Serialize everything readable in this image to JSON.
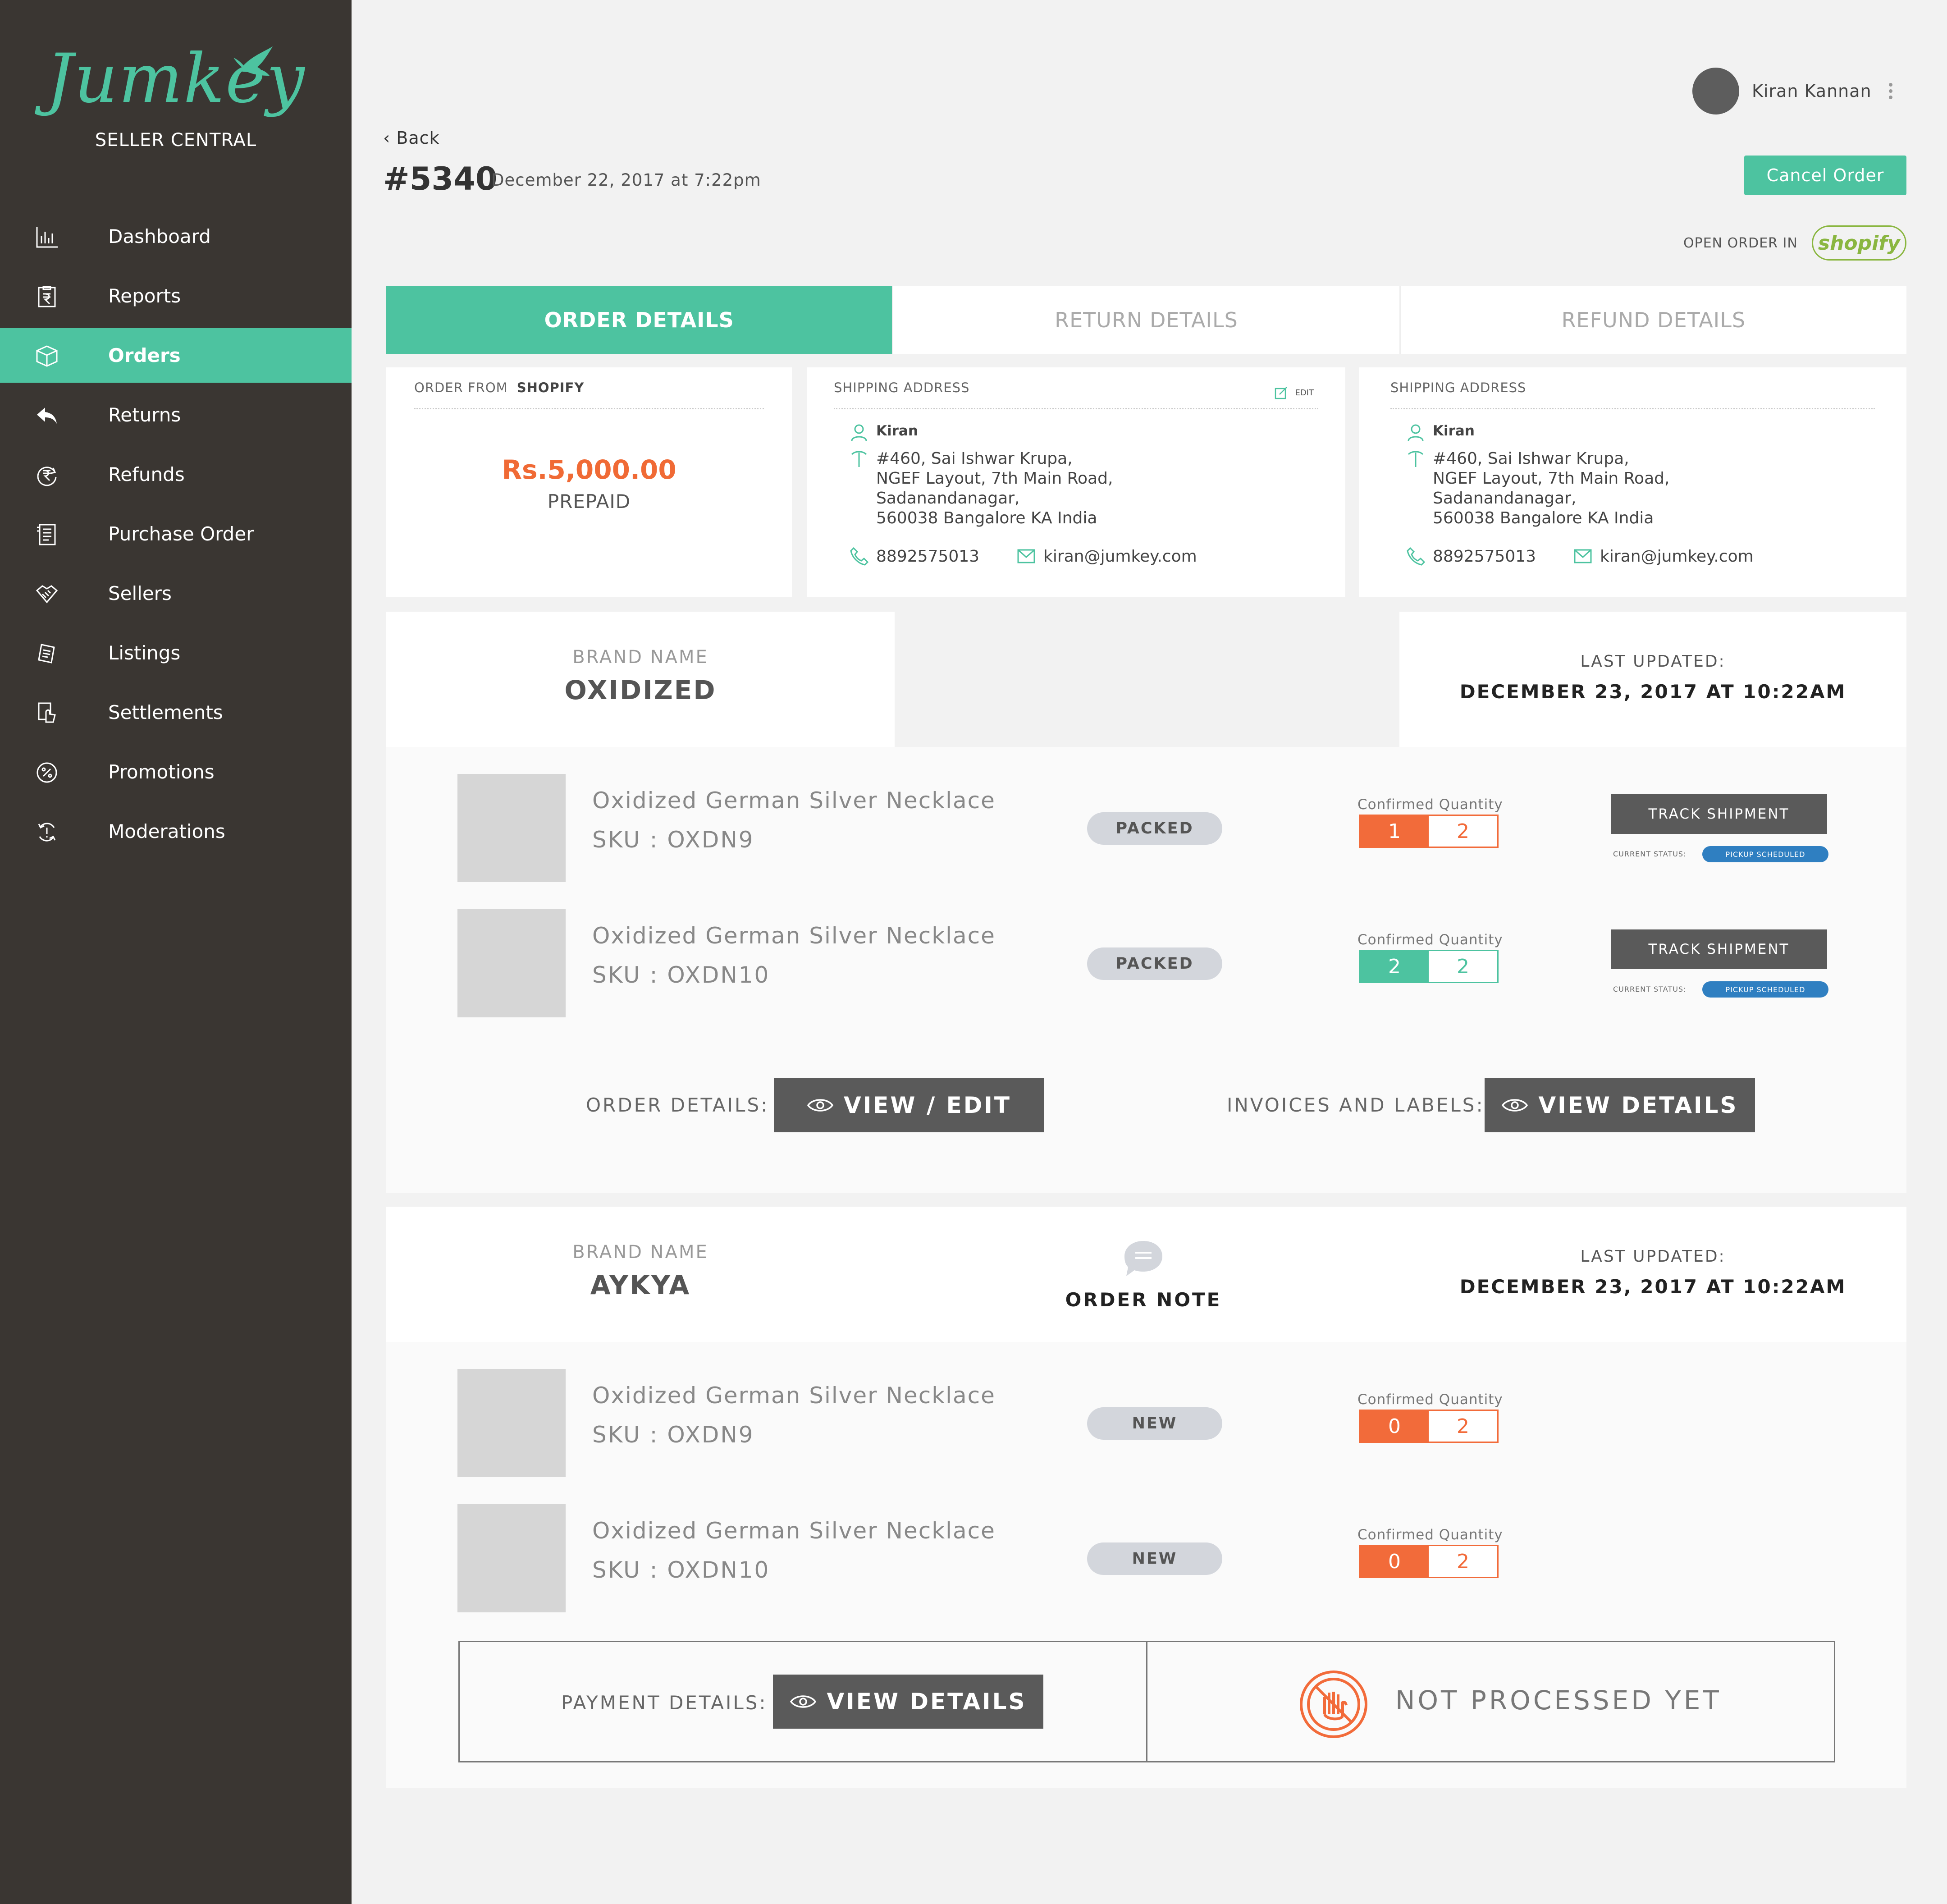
{
  "sidebar": {
    "logo": "Jumkey",
    "subtitle": "SELLER CENTRAL",
    "items": [
      {
        "label": "Dashboard",
        "icon": "bar-chart-icon"
      },
      {
        "label": "Reports",
        "icon": "rupee-document-icon"
      },
      {
        "label": "Orders",
        "icon": "box-icon",
        "active": true
      },
      {
        "label": "Returns",
        "icon": "return-arrow-icon"
      },
      {
        "label": "Refunds",
        "icon": "rupee-cycle-icon"
      },
      {
        "label": "Purchase Order",
        "icon": "purchase-order-icon"
      },
      {
        "label": "Sellers",
        "icon": "handshake-icon"
      },
      {
        "label": "Listings",
        "icon": "listings-icon"
      },
      {
        "label": "Settlements",
        "icon": "settlements-icon"
      },
      {
        "label": "Promotions",
        "icon": "percent-badge-icon"
      },
      {
        "label": "Moderations",
        "icon": "moderation-icon"
      }
    ]
  },
  "header": {
    "user_name": "Kiran Kannan",
    "back_label": "Back",
    "order_number": "#5340",
    "order_date": "December 22, 2017 at 7:22pm",
    "cancel_label": "Cancel Order",
    "open_in_label": "OPEN ORDER IN",
    "shopify_label": "shopify"
  },
  "tabs": [
    "ORDER DETAILS",
    "RETURN DETAILS",
    "REFUND DETAILS"
  ],
  "order_card": {
    "from_label": "ORDER FROM",
    "from_value": "SHOPIFY",
    "amount": "Rs.5,000.00",
    "payment_type": "PREPAID"
  },
  "shipping_cards": [
    {
      "title": "SHIPPING ADDRESS",
      "edit_label": "EDIT",
      "name": "Kiran",
      "address": [
        "#460, Sai Ishwar Krupa,",
        "NGEF Layout, 7th Main Road,",
        "Sadanandanagar,",
        "560038 Bangalore KA India"
      ],
      "phone": "8892575013",
      "email": "kiran@jumkey.com"
    },
    {
      "title": "SHIPPING ADDRESS",
      "name": "Kiran",
      "address": [
        "#460, Sai Ishwar Krupa,",
        "NGEF Layout, 7th Main Road,",
        "Sadanandanagar,",
        "560038 Bangalore KA India"
      ],
      "phone": "8892575013",
      "email": "kiran@jumkey.com"
    }
  ],
  "brands": [
    {
      "brand_label": "BRAND NAME",
      "brand_name": "OXIDIZED",
      "updated_label": "LAST UPDATED:",
      "updated_value": "DECEMBER 23, 2017 AT 10:22AM",
      "items": [
        {
          "name": "Oxidized German Silver Necklace",
          "sku": "SKU : OXDN9",
          "status": "PACKED",
          "qty_label": "Confirmed Quantity",
          "qty_confirmed": "1",
          "qty_total": "2",
          "track_label": "TRACK SHIPMENT",
          "current_status_label": "CURRENT STATUS:",
          "current_status": "PICKUP SCHEDULED"
        },
        {
          "name": "Oxidized German Silver Necklace",
          "sku": "SKU : OXDN10",
          "status": "PACKED",
          "qty_label": "Confirmed Quantity",
          "qty_confirmed": "2",
          "qty_total": "2",
          "track_label": "TRACK SHIPMENT",
          "current_status_label": "CURRENT STATUS:",
          "current_status": "PICKUP SCHEDULED"
        }
      ],
      "order_details_label": "ORDER DETAILS:",
      "order_details_button": "VIEW / EDIT",
      "invoices_label": "INVOICES AND LABELS:",
      "invoices_button": "VIEW DETAILS"
    },
    {
      "brand_label": "BRAND NAME",
      "brand_name": "AYKYA",
      "note_label": "ORDER NOTE",
      "updated_label": "LAST UPDATED:",
      "updated_value": "DECEMBER 23, 2017 AT 10:22AM",
      "items": [
        {
          "name": "Oxidized German Silver Necklace",
          "sku": "SKU : OXDN9",
          "status": "NEW",
          "qty_label": "Confirmed Quantity",
          "qty_confirmed": "0",
          "qty_total": "2"
        },
        {
          "name": "Oxidized German Silver Necklace",
          "sku": "SKU : OXDN10",
          "status": "NEW",
          "qty_label": "Confirmed Quantity",
          "qty_confirmed": "0",
          "qty_total": "2"
        }
      ],
      "payment_label": "PAYMENT DETAILS:",
      "payment_button": "VIEW DETAILS",
      "not_processed": "NOT PROCESSED YET"
    }
  ],
  "colors": {
    "accent": "#4dc3a0",
    "sidebar": "#3a3632",
    "orange": "#f26b3a",
    "status_blue": "#2f7fc1"
  }
}
